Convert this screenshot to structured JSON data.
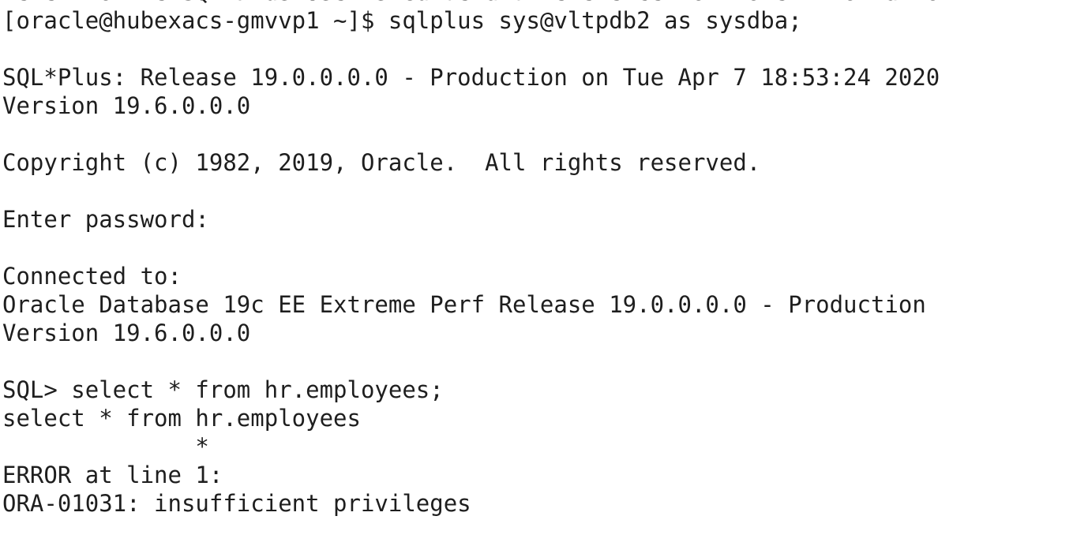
{
  "terminal": {
    "lines": [
      "Refer to the SQL*Plus User's Guide and Reference for more information.",
      "[oracle@hubexacs-gmvvp1 ~]$ sqlplus sys@vltpdb2 as sysdba;",
      "",
      "SQL*Plus: Release 19.0.0.0.0 - Production on Tue Apr 7 18:53:24 2020",
      "Version 19.6.0.0.0",
      "",
      "Copyright (c) 1982, 2019, Oracle.  All rights reserved.",
      "",
      "Enter password:",
      "",
      "Connected to:",
      "Oracle Database 19c EE Extreme Perf Release 19.0.0.0.0 - Production",
      "Version 19.6.0.0.0",
      "",
      "SQL> select * from hr.employees;",
      "select * from hr.employees",
      "              *",
      "ERROR at line 1:",
      "ORA-01031: insufficient privileges"
    ]
  }
}
